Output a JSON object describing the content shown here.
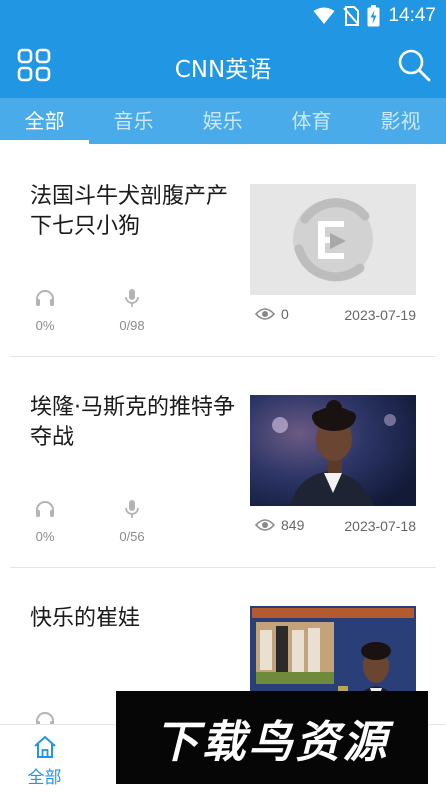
{
  "status_bar": {
    "time": "14:47",
    "icons": [
      "wifi-icon",
      "no-sim-icon",
      "battery-charging-icon"
    ]
  },
  "app_bar": {
    "title": "CNN英语",
    "left_icon": "grid-menu-icon",
    "right_icon": "search-icon"
  },
  "tabs": [
    {
      "label": "全部",
      "active": true
    },
    {
      "label": "音乐",
      "active": false
    },
    {
      "label": "娱乐",
      "active": false
    },
    {
      "label": "体育",
      "active": false
    },
    {
      "label": "影视",
      "active": false
    }
  ],
  "news": [
    {
      "title": "法国斗牛犬剖腹产产下七只小狗",
      "listen_percent": "0%",
      "record_count": "0/98",
      "views": "0",
      "date": "2023-07-19",
      "thumbnail": "placeholder-logo"
    },
    {
      "title": "埃隆·马斯克的推特争夺战",
      "listen_percent": "0%",
      "record_count": "0/56",
      "views": "849",
      "date": "2023-07-18",
      "thumbnail": "tv-host-photo"
    },
    {
      "title": "快乐的崔娃",
      "listen_percent": "",
      "record_count": "",
      "views": "",
      "date": "",
      "thumbnail": "tv-host-with-screen-photo"
    }
  ],
  "bottom_nav": [
    {
      "label": "全部",
      "icon": "home-icon",
      "active": true
    }
  ],
  "watermark": "下载鸟资源",
  "colors": {
    "primary": "#2196e3",
    "tab_bar": "#49abea",
    "muted_text": "#8c8c8c"
  }
}
